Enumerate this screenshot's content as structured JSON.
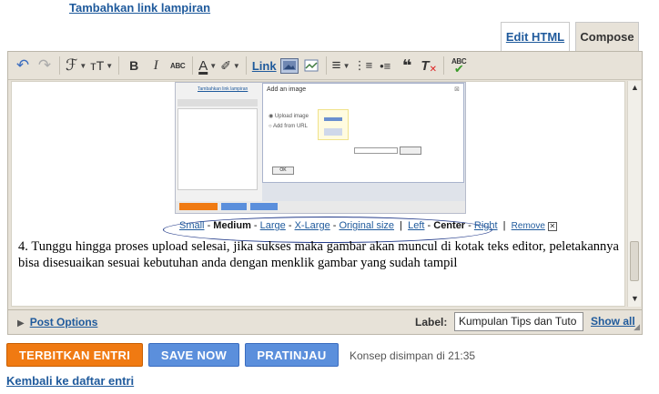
{
  "top_link": "Tambahkan link lampiran",
  "tabs": {
    "edit_html": "Edit HTML",
    "compose": "Compose"
  },
  "toolbar": {
    "undo": "↶",
    "redo": "↷",
    "font": "ℱ",
    "font_size": "тT",
    "bold": "B",
    "italic": "I",
    "strikethrough": "ABC",
    "text_color": "A",
    "highlight": "✐",
    "link": "Link",
    "align": "≡",
    "numbered_list": "⋮≡",
    "bullet_list": "•≡",
    "quote": "❝",
    "remove_format": "T",
    "spellcheck": "ABC"
  },
  "embed": {
    "dialog_title": "Add an image",
    "close": "⊠",
    "option_upload": "◉ Upload image",
    "option_url": "○ Add from URL",
    "ok": "OK",
    "side_text": "Tambahkan link lampiran"
  },
  "size_bar": {
    "small": "Small",
    "medium": "Medium",
    "large": "Large",
    "xlarge": "X-Large",
    "original": "Original size",
    "left": "Left",
    "center": "Center",
    "right": "Right",
    "remove": "Remove"
  },
  "paragraph": "4. Tunggu hingga proses upload selesai, jika sukses maka gambar akan muncul di kotak teks editor, peletakannya bisa disesuaikan sesuai kebutuhan anda dengan menklik gambar yang sudah tampil",
  "post_options": "Post Options",
  "label": {
    "text": "Label:",
    "value": "Kumpulan Tips dan Tuto",
    "show_all": "Show all"
  },
  "buttons": {
    "publish": "TERBITKAN ENTRI",
    "save": "SAVE NOW",
    "preview": "PRATINJAU"
  },
  "saved_msg": "Konsep disimpan di 21:35",
  "back_link": "Kembali ke daftar entri",
  "colors": {
    "link": "#1f5a9c",
    "publish": "#f07a12",
    "save": "#5b8fdc",
    "frame": "#e7e2d8"
  }
}
